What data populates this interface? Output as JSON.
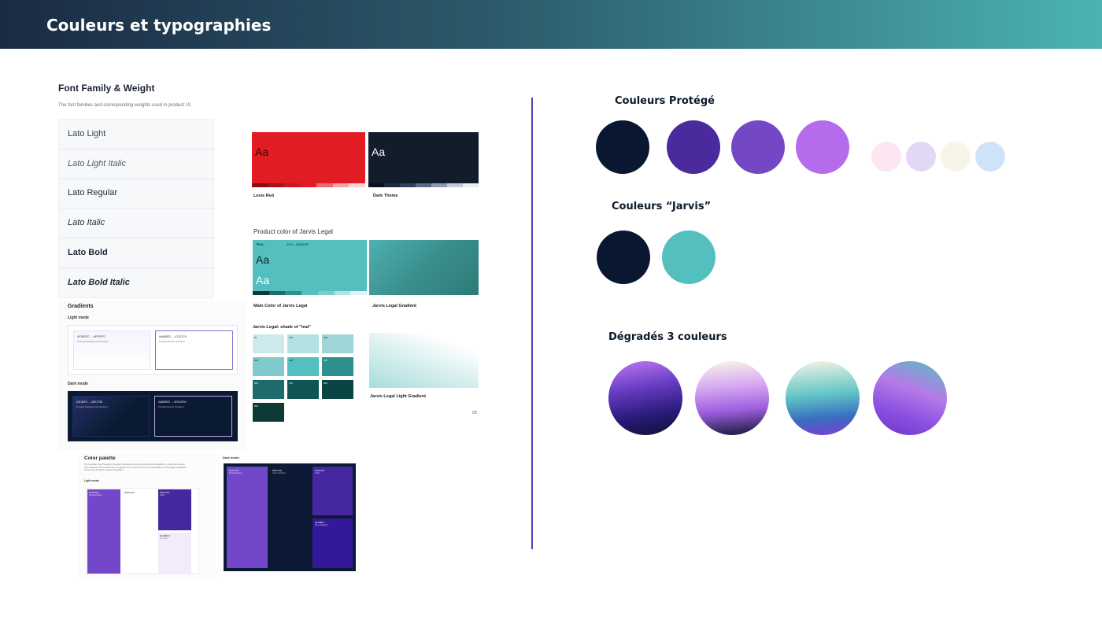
{
  "header": {
    "title": "Couleurs et typographies"
  },
  "font_family": {
    "title": "Font Family & Weight",
    "subtitle": "The font families and corresponding weights used in product UI.",
    "items": [
      "Lato Light",
      "Lato Light Italic",
      "Lato Regular",
      "Lato Italic",
      "Lato Bold",
      "Lato Bold Italic"
    ]
  },
  "cards": {
    "aa": "Aa",
    "lexis_red_caption": "Lexis Red",
    "dark_theme_caption": "Dark Theme",
    "product_color_title": "Product color of Jarvis Legal",
    "teal_label": "TEAL",
    "teal_hex": "40% · #54BFBF",
    "main_color_caption": "Main Color of Jarvis Legal",
    "legal_gradient_caption": "Jarvis Legal Gradient",
    "shades_title": "Jarvis Legal: shade of \"teal\"",
    "light_gradient_caption": "Jarvis Legal Light Gradient",
    "page_number": "03"
  },
  "teal_shades": [
    {
      "label": "50",
      "hex": "#CCE9EB"
    },
    {
      "label": "100",
      "hex": "#B3E1E3"
    },
    {
      "label": "200",
      "hex": "#9ED6D8"
    },
    {
      "label": "300",
      "hex": "#80C9CC"
    },
    {
      "label": "400",
      "hex": "#54BFBF"
    },
    {
      "label": "500",
      "hex": "#2E8F8C"
    },
    {
      "label": "600",
      "hex": "#1D6B6A"
    },
    {
      "label": "700",
      "hex": "#0F5553"
    },
    {
      "label": "800",
      "hex": "#0A4443"
    },
    {
      "label": "900",
      "hex": "#0C3A35"
    }
  ],
  "gradients": {
    "title": "Gradients",
    "light_label": "Light mode",
    "dark_label": "Dark mode",
    "light_a": "#F1EBFC → #FFFFFF",
    "light_a_sub": "Protégé Background Gradient",
    "light_b": "#A689ED → #7247C9",
    "light_b_sub": "Protégé Border Gradient",
    "dark_a": "#3138F0 → #00173E",
    "dark_a_sub": "Protégé Background Gradient",
    "dark_b": "#A689ED → #D9C5FA",
    "dark_b_sub": "Protégé Border Gradient"
  },
  "color_palette": {
    "title": "Color palette",
    "desc": "It is important that Protégé is branded consistently and correctly across all platforms, products, services and materials. This builds trust, recognition and a sense of the essential ambitions of Protégé capabilities across the seamless product ecosystem.",
    "light_label": "Light mode",
    "dark_label": "Dark mode",
    "light_swatches": [
      "#7247C9",
      "#FFFFFF",
      "#4527A0",
      "#F1EBFC"
    ],
    "light_names": [
      "Protégé Brand",
      "",
      "Violet",
      "Lavender"
    ],
    "dark_swatches": [
      "#7247C9",
      "#00173E",
      "#4527A0",
      "#3138F0"
    ],
    "dark_names": [
      "Protégé Brand",
      "Jarvis Midnight",
      "Violet",
      "Deep Sapphire"
    ]
  },
  "protege": {
    "title": "Couleurs Protégé",
    "big": [
      "#0a1730",
      "#4a2a9c",
      "#7447c4",
      "#b56cec"
    ],
    "small": [
      "#fbe6f1",
      "#e2d8f5",
      "#f7f4ea",
      "#cfe3f8"
    ]
  },
  "jarvis": {
    "title": "Couleurs “Jarvis”",
    "colors": [
      "#0a1730",
      "#54bfbf"
    ]
  },
  "gradients3": {
    "title": "Dégradés 3 couleurs"
  }
}
